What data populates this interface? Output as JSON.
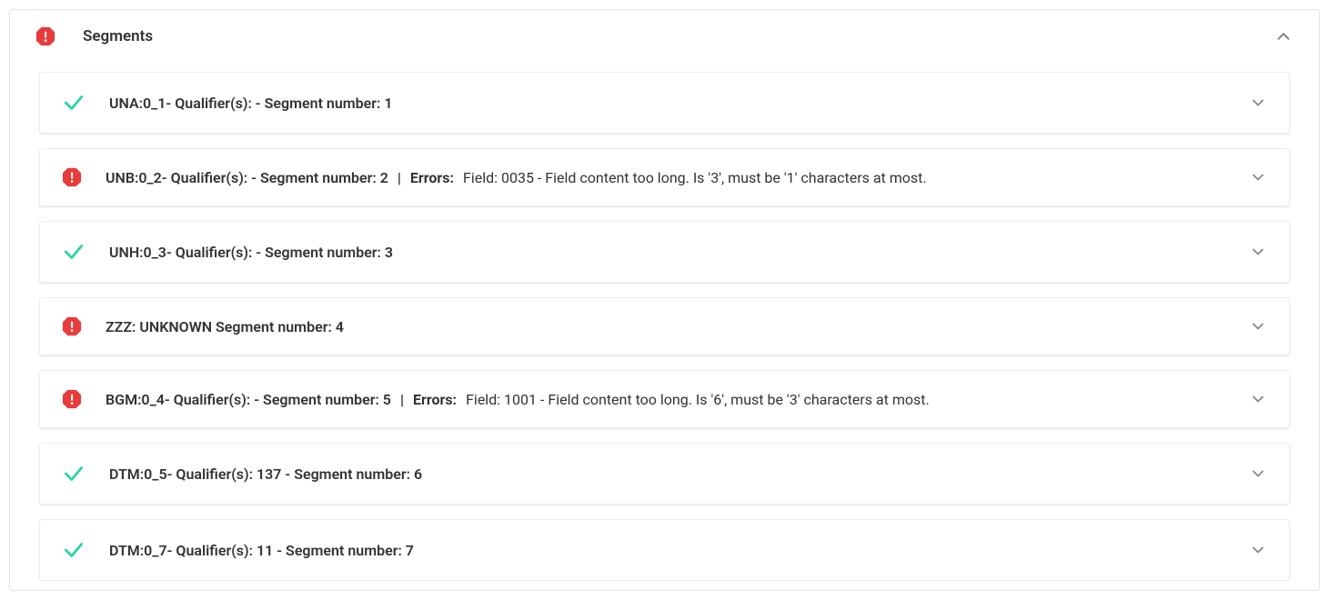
{
  "panel": {
    "title": "Segments",
    "status": "error"
  },
  "errors_label": "Errors:",
  "segments": [
    {
      "status": "ok",
      "title": "UNA:0_1- Qualifier(s): - Segment number: 1",
      "error": null
    },
    {
      "status": "error",
      "title": "UNB:0_2- Qualifier(s): - Segment number: 2",
      "error": "Field: 0035 - Field content too long. Is '3', must be '1' characters at most."
    },
    {
      "status": "ok",
      "title": "UNH:0_3- Qualifier(s): - Segment number: 3",
      "error": null
    },
    {
      "status": "error",
      "title": "ZZZ: UNKNOWN Segment number: 4",
      "error": null
    },
    {
      "status": "error",
      "title": "BGM:0_4- Qualifier(s): - Segment number: 5",
      "error": "Field: 1001 - Field content too long. Is '6', must be '3' characters at most."
    },
    {
      "status": "ok",
      "title": "DTM:0_5- Qualifier(s): 137 - Segment number: 6",
      "error": null
    },
    {
      "status": "ok",
      "title": "DTM:0_7- Qualifier(s): 11 - Segment number: 7",
      "error": null
    }
  ]
}
